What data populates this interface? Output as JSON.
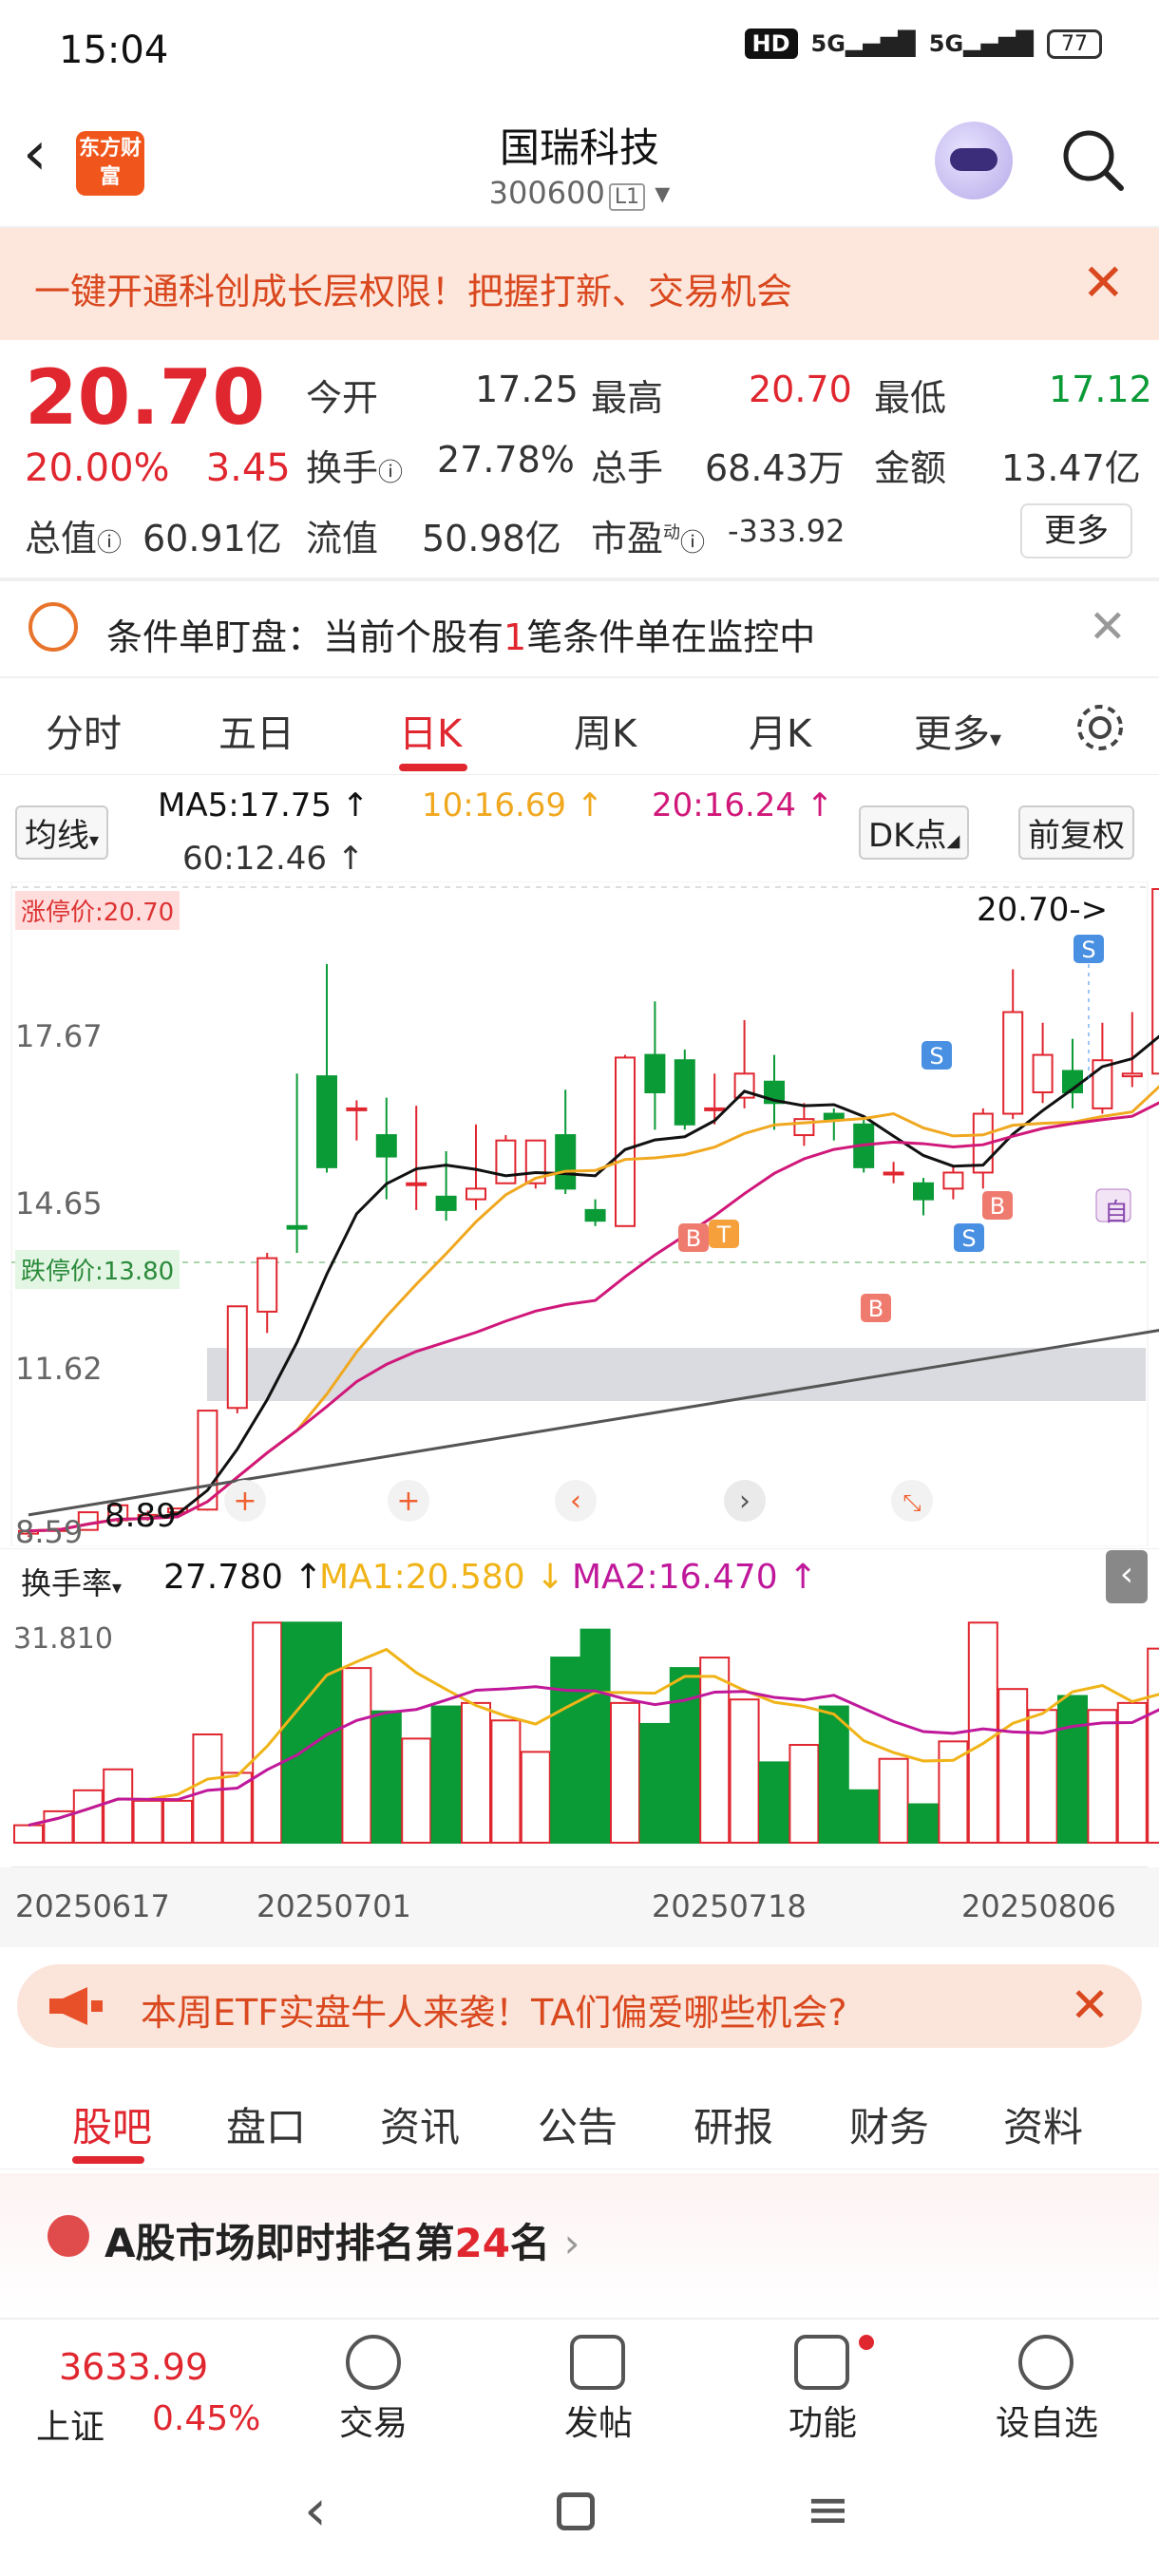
{
  "status": {
    "time": "15:04",
    "hd": "HD",
    "net1": "5G",
    "net2": "5G",
    "battery": "77"
  },
  "header": {
    "title": "国瑞科技",
    "code": "300600",
    "level": "L1",
    "logo": "东方财富"
  },
  "banner": {
    "text": "一键开通科创成长层权限！把握打新、交易机会"
  },
  "quote": {
    "price": "20.70",
    "change_pct": "20.00%",
    "change": "3.45",
    "open_label": "今开",
    "open": "17.25",
    "high_label": "最高",
    "high": "20.70",
    "low_label": "最低",
    "low": "17.12",
    "turnover_label": "换手",
    "turnover": "27.78%",
    "volume_label": "总手",
    "volume": "68.43万",
    "amount_label": "金额",
    "amount": "13.47亿",
    "mcap_label": "总值",
    "mcap": "60.91亿",
    "float_label": "流值",
    "float": "50.98亿",
    "pe_label": "市盈",
    "pe_sup": "动",
    "pe": "-333.92",
    "more": "更多"
  },
  "monitor": {
    "text_a": "条件单盯盘：当前个股有",
    "count": "1",
    "text_b": "笔条件单在监控中"
  },
  "tabs": [
    "分时",
    "五日",
    "日K",
    "周K",
    "月K",
    "更多"
  ],
  "chart_header": {
    "ma_select": "均线",
    "ma5": "MA5:17.75 ↑",
    "ma10": "10:16.69 ↑",
    "ma20": "20:16.24 ↑",
    "ma60": "60:12.46 ↑",
    "dk": "DK点",
    "adjust": "前复权"
  },
  "chart_labels": {
    "limit_up": "涨停价:20.70",
    "limit_down": "跌停价:13.80",
    "y1": "17.67",
    "y2": "14.65",
    "y3": "11.62",
    "y4": "8.59",
    "last_price": "20.70->",
    "low_mark": "8.89",
    "auto": "自"
  },
  "vol_header": {
    "select": "换手率",
    "value": "27.780 ↑",
    "ma1": "MA1:20.580 ↓",
    "ma2": "MA2:16.470 ↑",
    "max": "31.810"
  },
  "dates": [
    "20250617",
    "20250701",
    "20250718",
    "20250806"
  ],
  "colors": {
    "up": "#e0262f",
    "down": "#0a9a36",
    "ma5": "#111111",
    "ma10": "#f0a820",
    "ma20": "#d0187a",
    "ma60": "#555555"
  },
  "chart_data": {
    "type": "candlestick",
    "ohlc": [
      [
        8.65,
        8.7,
        8.62,
        8.59
      ],
      [
        8.7,
        8.74,
        8.68,
        8.66
      ],
      [
        8.72,
        9.05,
        8.7,
        8.7
      ],
      [
        8.9,
        9.18,
        8.92,
        8.86
      ],
      [
        8.95,
        9.0,
        9.08,
        8.89
      ],
      [
        9.05,
        9.12,
        9.04,
        9.0
      ],
      [
        9.1,
        10.95,
        10.9,
        9.08
      ],
      [
        11.0,
        12.9,
        12.0,
        10.9
      ],
      [
        12.8,
        13.8,
        13.9,
        12.4
      ],
      [
        14.4,
        14.35,
        17.25,
        13.9
      ],
      [
        17.2,
        15.5,
        19.3,
        15.4
      ],
      [
        16.6,
        16.6,
        16.75,
        16.0
      ],
      [
        16.1,
        15.7,
        16.8,
        14.9
      ],
      [
        15.2,
        15.2,
        16.65,
        14.7
      ],
      [
        14.95,
        14.7,
        15.8,
        14.5
      ],
      [
        14.9,
        15.1,
        16.3,
        14.7
      ],
      [
        15.2,
        16.0,
        16.1,
        15.2
      ],
      [
        15.2,
        16.0,
        16.0,
        15.1
      ],
      [
        16.1,
        15.1,
        16.95,
        15.0
      ],
      [
        14.7,
        14.5,
        14.9,
        14.4
      ],
      [
        14.4,
        17.55,
        17.6,
        14.4
      ],
      [
        17.6,
        16.9,
        18.6,
        16.2
      ],
      [
        17.5,
        16.3,
        17.7,
        16.2
      ],
      [
        16.6,
        16.6,
        17.25,
        16.3
      ],
      [
        16.8,
        17.25,
        18.25,
        16.6
      ],
      [
        17.1,
        16.7,
        17.6,
        16.2
      ],
      [
        16.1,
        16.4,
        16.7,
        15.9
      ],
      [
        16.5,
        16.4,
        16.6,
        16.0
      ],
      [
        16.3,
        15.5,
        16.4,
        15.4
      ],
      [
        15.4,
        15.4,
        15.6,
        15.2
      ],
      [
        15.2,
        14.9,
        15.3,
        14.6
      ],
      [
        15.1,
        15.4,
        15.5,
        14.9
      ],
      [
        15.4,
        16.5,
        16.6,
        15.1
      ],
      [
        16.5,
        18.4,
        19.2,
        16.4
      ],
      [
        16.9,
        17.6,
        18.2,
        16.7
      ],
      [
        17.3,
        16.9,
        17.9,
        16.6
      ],
      [
        16.6,
        17.5,
        18.2,
        16.5
      ],
      [
        17.2,
        17.25,
        18.4,
        17.0
      ],
      [
        17.25,
        20.7,
        20.7,
        17.12
      ]
    ],
    "turnover": [
      2.5,
      4.5,
      7.5,
      10.5,
      6.0,
      6.0,
      15.5,
      10.0,
      31.5,
      31.5,
      31.5,
      25.0,
      18.8,
      14.9,
      19.5,
      20.0,
      17.5,
      13.0,
      26.5,
      30.5,
      20.0,
      17.0,
      25.0,
      26.5,
      20.5,
      11.5,
      14.0,
      19.5,
      7.5,
      12.0,
      5.5,
      14.5,
      31.5,
      22.0,
      19.0,
      21.0,
      19.0,
      20.0,
      27.78
    ],
    "ylim": [
      8.59,
      20.7
    ]
  },
  "ad": {
    "text": "本周ETF实盘牛人来袭！TA们偏爱哪些机会?"
  },
  "bottom_tabs": [
    "股吧",
    "盘口",
    "资讯",
    "公告",
    "研报",
    "财务",
    "资料"
  ],
  "rank": {
    "text": "A股市场即时排名第",
    "num": "24",
    "suffix": "名"
  },
  "bottom_bar": {
    "index": "3633.99",
    "index_name": "上证",
    "index_pct": "0.45%",
    "items": [
      "交易",
      "发帖",
      "功能",
      "设自选"
    ]
  }
}
